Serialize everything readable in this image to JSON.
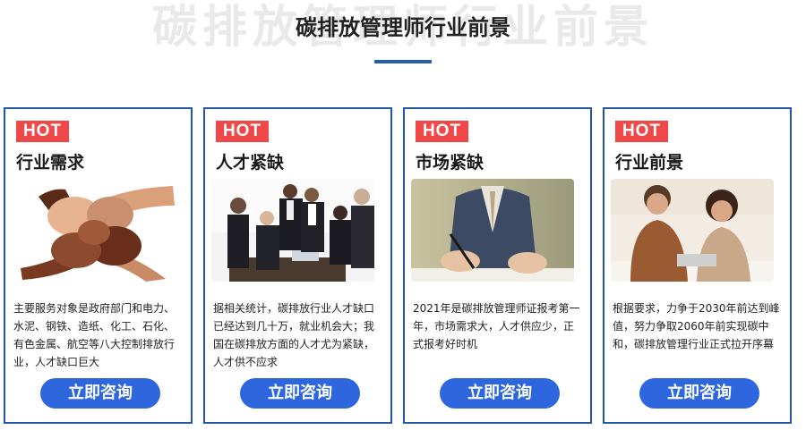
{
  "header": {
    "bg_title": "碳排放管理师行业前景",
    "title": "碳排放管理师行业前景"
  },
  "cards": [
    {
      "badge": "HOT",
      "title": "行业需求",
      "image": "hands-teamwork-photo",
      "description": "主要服务对象是政府部门和电力、水泥、钢铁、造纸、化工、石化、有色金属、航空等八大控制排放行业，人才缺口巨大",
      "button": "立即咨询"
    },
    {
      "badge": "HOT",
      "title": "人才紧缺",
      "image": "business-team-handshake-photo",
      "description": "据相关统计，碳排放行业人才缺口已经达到几十万，就业机会大；我国在碳排放方面的人才尤为紧缺，人才供不应求",
      "button": "立即咨询"
    },
    {
      "badge": "HOT",
      "title": "市场紧缺",
      "image": "businessman-signing-photo",
      "description": "2021年是碳排放管理师证报考第一年，市场需求大，人才供应少，正式报考好时机",
      "button": "立即咨询"
    },
    {
      "badge": "HOT",
      "title": "行业前景",
      "image": "colleagues-laptop-photo",
      "description": "根据要求，力争于2030年前达到峰值，努力争取2060年前实现碳中和，碳排放管理行业正式拉开序幕",
      "button": "立即咨询"
    }
  ],
  "colors": {
    "accent_blue": "#2e66dd",
    "border_blue": "#2456a6",
    "hot_red": "#f04848"
  }
}
